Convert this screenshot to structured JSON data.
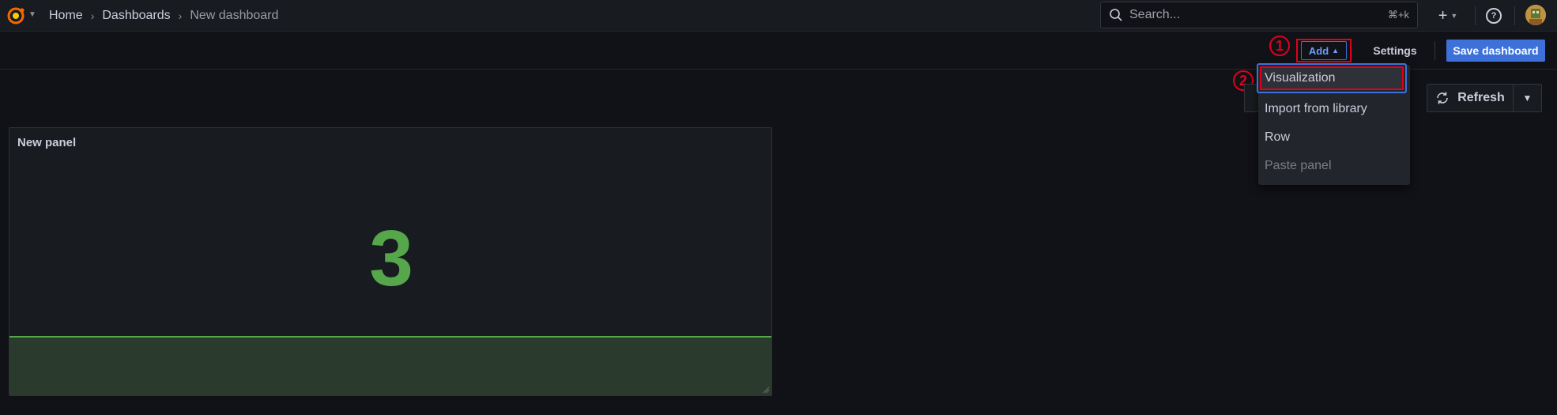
{
  "topbar": {
    "breadcrumb": [
      "Home",
      "Dashboards",
      "New dashboard"
    ],
    "search": {
      "placeholder": "Search...",
      "shortcut": "⌘+k"
    },
    "plus_label": "+"
  },
  "toolbar": {
    "add_label": "Add",
    "settings_label": "Settings",
    "save_label": "Save dashboard"
  },
  "refresh": {
    "label": "Refresh"
  },
  "annotations": {
    "step1": "1",
    "step2": "2"
  },
  "add_menu": {
    "items": [
      {
        "label": "Visualization",
        "state": "focused"
      },
      {
        "label": "Import from library",
        "state": "normal"
      },
      {
        "label": "Row",
        "state": "normal"
      },
      {
        "label": "Paste panel",
        "state": "disabled"
      }
    ]
  },
  "panel": {
    "title": "New panel",
    "value": "3"
  },
  "colors": {
    "background": "#111217",
    "primary": "#3d71d9",
    "stat_green": "#56a64b",
    "highlight_red": "#e0001b"
  }
}
